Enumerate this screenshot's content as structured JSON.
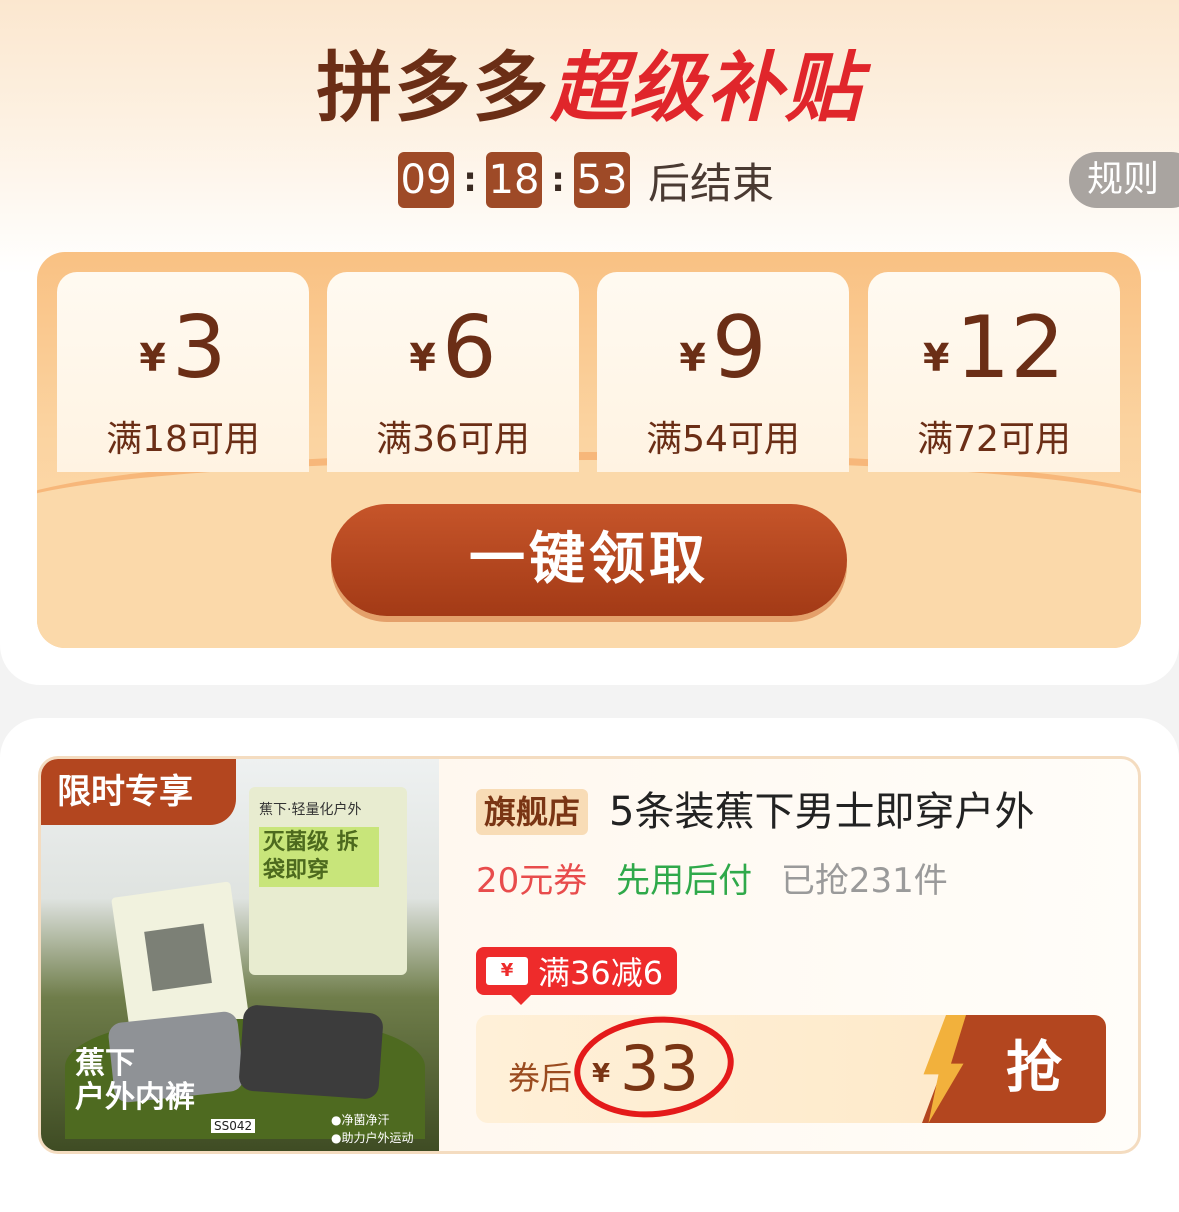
{
  "header": {
    "title_prefix": "拼多多",
    "title_highlight": "超级补贴",
    "countdown": {
      "hours": "09",
      "minutes": "18",
      "seconds": "53",
      "separator": ":",
      "suffix": "后结束"
    },
    "rules_label": "规则"
  },
  "coupons": [
    {
      "currency": "¥",
      "amount": "3",
      "condition": "满18可用"
    },
    {
      "currency": "¥",
      "amount": "6",
      "condition": "满36可用"
    },
    {
      "currency": "¥",
      "amount": "9",
      "condition": "满54可用"
    },
    {
      "currency": "¥",
      "amount": "12",
      "condition": "满72可用"
    }
  ],
  "claim_all_label": "一键领取",
  "product": {
    "badge": "限时专享",
    "image_text": {
      "brand": "蕉下·轻量化户外",
      "pack_headline": "灭菌级 拆袋即穿",
      "title_line1": "蕉下",
      "title_line2": "户外内裤",
      "code": "SS042",
      "feature1": "●净菌净汗",
      "feature2": "●助力户外运动"
    },
    "shop_tag": "旗舰店",
    "title": "5条装蕉下男士即穿户外",
    "coupon_text": "20元券",
    "pay_later": "先用后付",
    "sold": "已抢231件",
    "deal_icon": "¥",
    "deal": "满36减6",
    "price_label": "券后",
    "currency": "¥",
    "price": "33",
    "grab_label": "抢"
  },
  "colors": {
    "brand_brown": "#6b2e16",
    "highlight_red": "#e0262b",
    "button_brown": "#b3461f",
    "pay_later_green": "#2fa94a",
    "coupon_red": "#e84c4c"
  }
}
